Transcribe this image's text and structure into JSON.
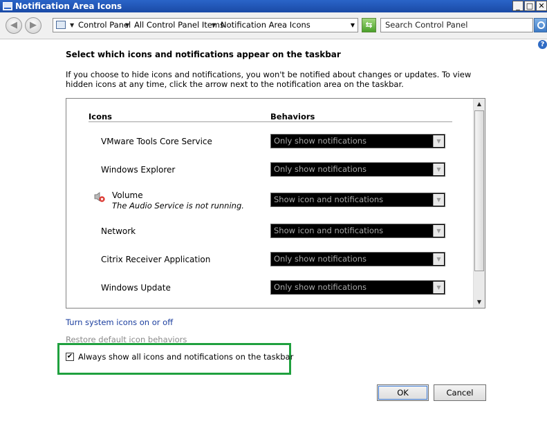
{
  "window": {
    "title": "Notification Area Icons",
    "controls": {
      "minimize": "_",
      "maximize": "□",
      "close": "✕"
    }
  },
  "address_bar": {
    "back": "◀",
    "forward": "▶",
    "breadcrumbs": [
      "Control Panel",
      "All Control Panel Items",
      "Notification Area Icons"
    ],
    "search_placeholder": "Search Control Panel"
  },
  "help": "?",
  "main": {
    "heading": "Select which icons and notifications appear on the taskbar",
    "description": "If you choose to hide icons and notifications, you won't be notified about changes or updates. To view hidden icons at any time, click the arrow next to the notification area on the taskbar.",
    "columns": {
      "icons": "Icons",
      "behaviors": "Behaviors"
    },
    "rows": [
      {
        "name": "VMware Tools Core Service",
        "behavior": "Only show notifications"
      },
      {
        "name": "Windows Explorer",
        "behavior": "Only show notifications"
      },
      {
        "name": "Volume",
        "subtitle": "The Audio Service is not running.",
        "behavior": "Show icon and notifications",
        "icon": "speaker-error-icon"
      },
      {
        "name": "Network",
        "behavior": "Show icon and notifications"
      },
      {
        "name": "Citrix Receiver Application",
        "behavior": "Only show notifications"
      },
      {
        "name": "Windows Update",
        "behavior": "Only show notifications"
      }
    ],
    "link_system_icons": "Turn system icons on or off",
    "link_restore": "Restore default icon behaviors",
    "checkbox": {
      "label": "Always show all icons and notifications on the taskbar",
      "checked": true
    },
    "buttons": {
      "ok": "OK",
      "cancel": "Cancel"
    }
  },
  "colors": {
    "highlight": "#1fa03e",
    "link": "#1a3d9e",
    "titlebar": "#2a64c8"
  }
}
